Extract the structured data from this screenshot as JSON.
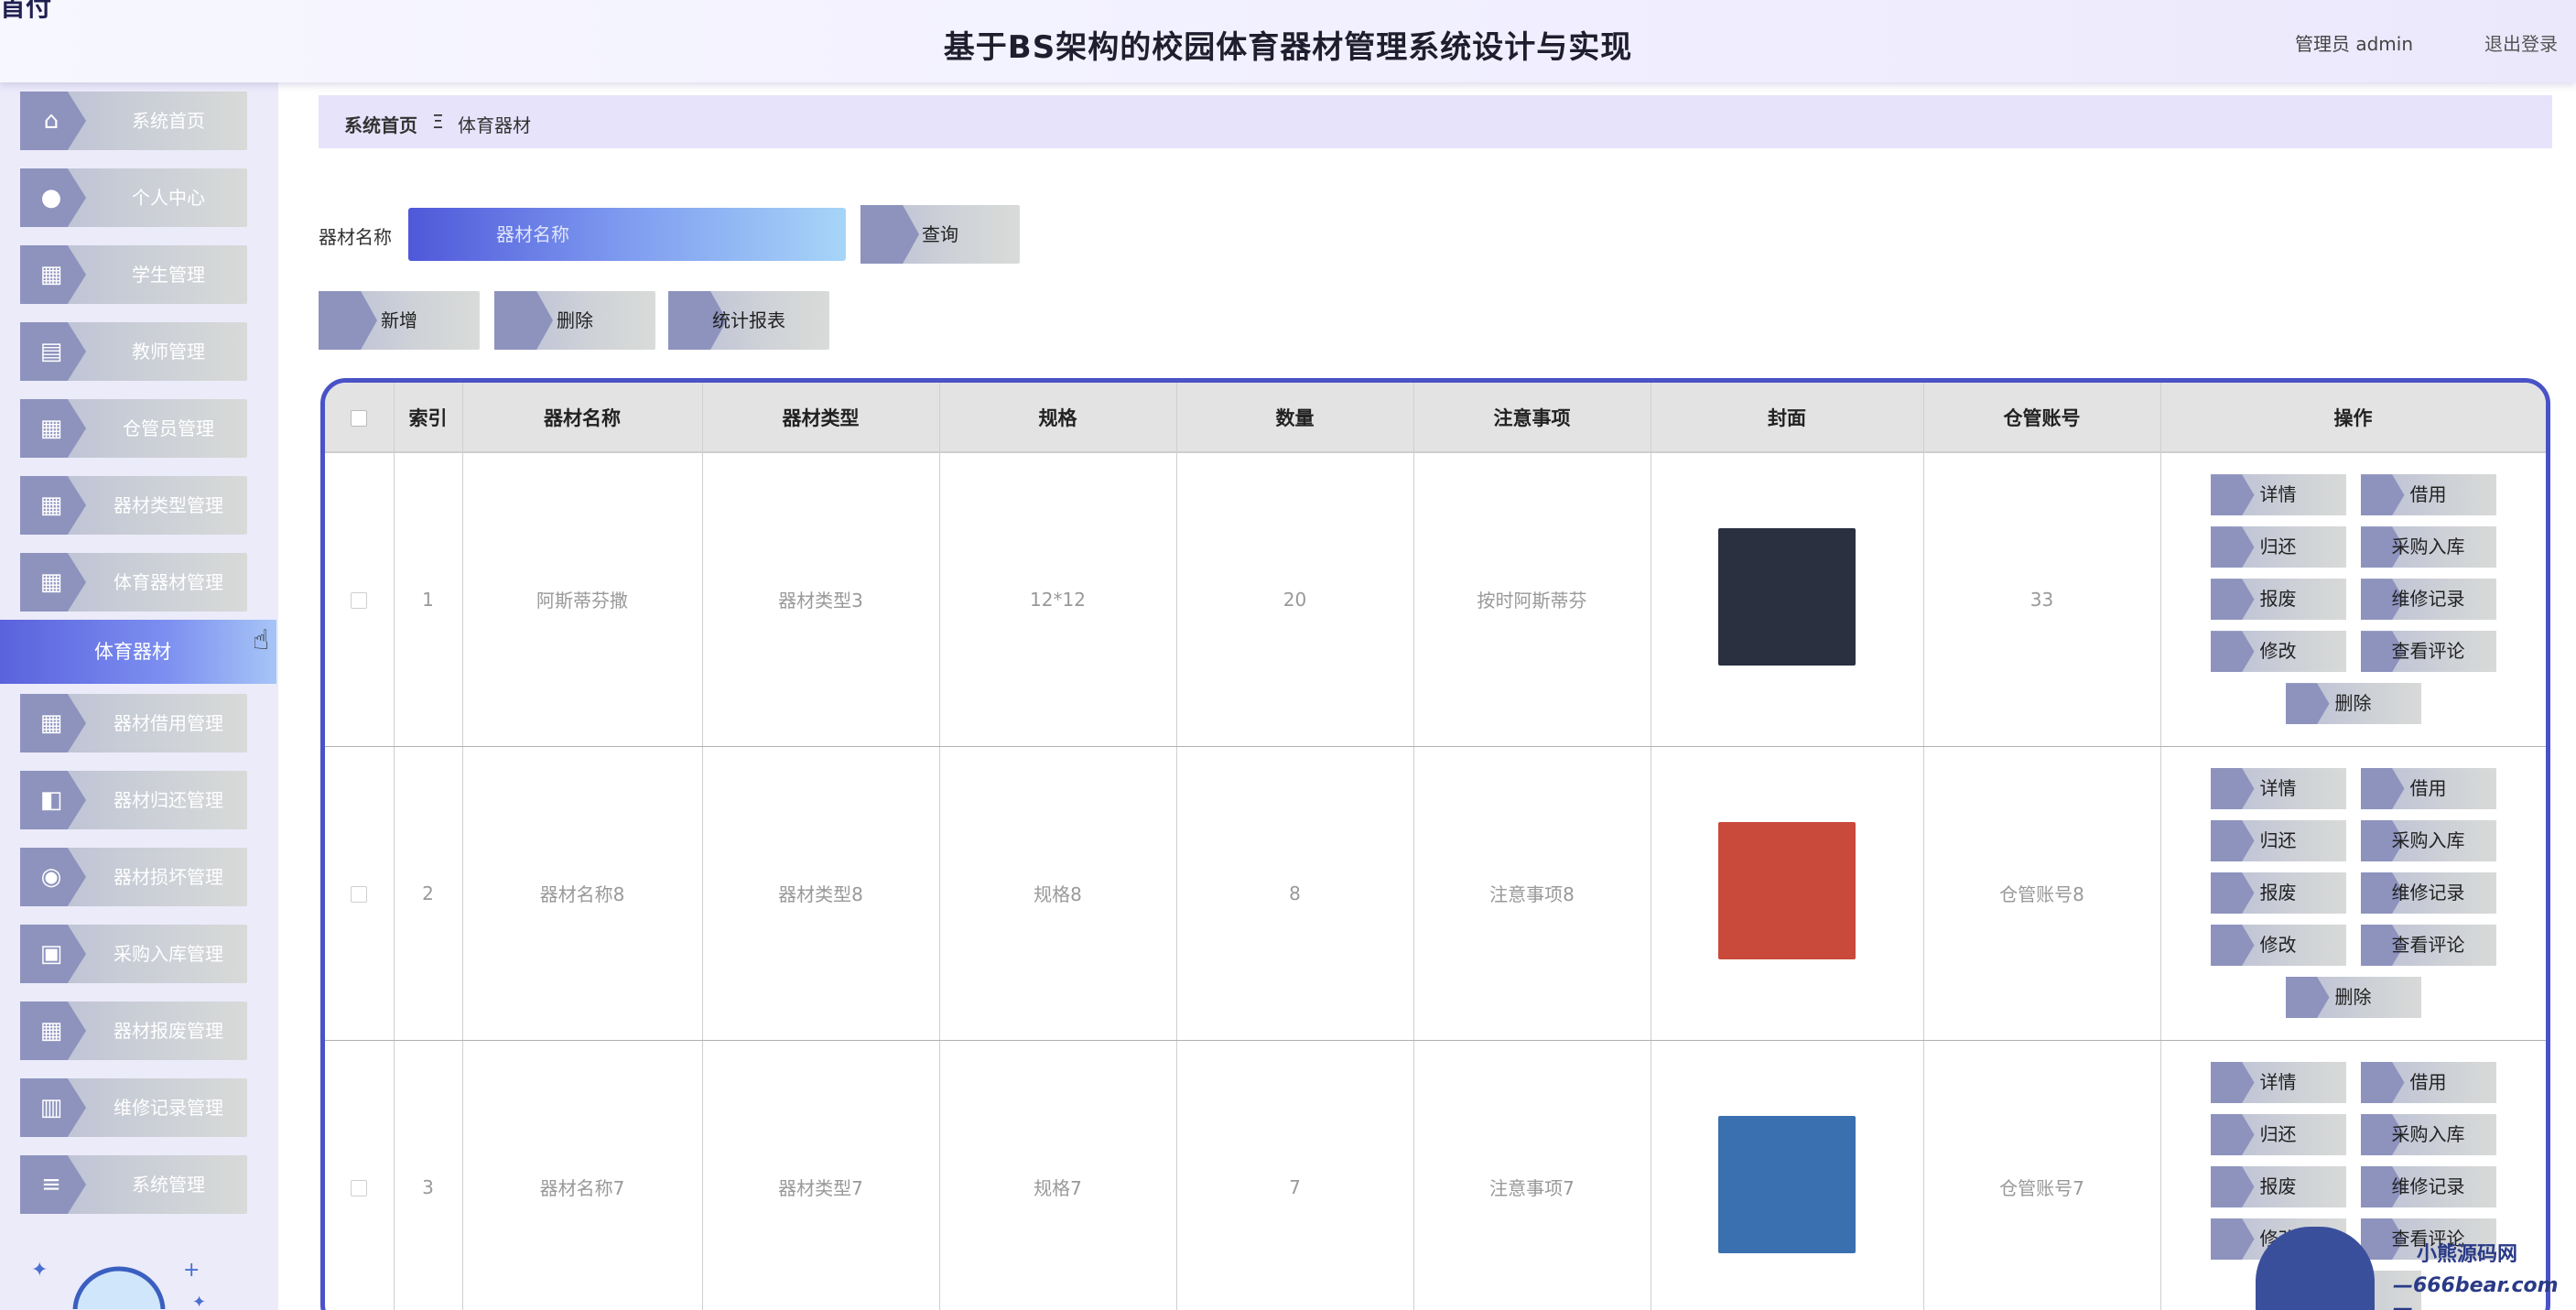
{
  "header": {
    "logo_text": "首付",
    "title": "基于BS架构的校园体育器材管理系统设计与实现",
    "user_label": "管理员 admin",
    "logout_label": "退出登录"
  },
  "sidebar": {
    "items": [
      {
        "label": "系统首页",
        "icon": "home-icon"
      },
      {
        "label": "个人中心",
        "icon": "user-icon"
      },
      {
        "label": "学生管理",
        "icon": "grid-icon"
      },
      {
        "label": "教师管理",
        "icon": "chart-icon"
      },
      {
        "label": "仓管员管理",
        "icon": "grid-icon"
      },
      {
        "label": "器材类型管理",
        "icon": "grid-icon"
      },
      {
        "label": "体育器材管理",
        "icon": "grid-icon"
      },
      {
        "label": "器材借用管理",
        "icon": "grid-icon"
      },
      {
        "label": "器材归还管理",
        "icon": "wallet-icon"
      },
      {
        "label": "器材损坏管理",
        "icon": "bulb-icon"
      },
      {
        "label": "采购入库管理",
        "icon": "clipboard-icon"
      },
      {
        "label": "器材报废管理",
        "icon": "grid-icon"
      },
      {
        "label": "维修记录管理",
        "icon": "bar-chart-icon"
      },
      {
        "label": "系统管理",
        "icon": "list-icon"
      }
    ],
    "active_label": "体育器材"
  },
  "breadcrumb": {
    "home": "系统首页",
    "separator": "Ξ",
    "current": "体育器材"
  },
  "search": {
    "label": "器材名称",
    "placeholder": "器材名称",
    "value": "",
    "query_button": "查询"
  },
  "toolbar": {
    "add": "新增",
    "delete": "删除",
    "report": "统计报表"
  },
  "table": {
    "headers": [
      "索引",
      "器材名称",
      "器材类型",
      "规格",
      "数量",
      "注意事项",
      "封面",
      "仓管账号",
      "操作"
    ],
    "rows": [
      {
        "index": "1",
        "name": "阿斯蒂芬撒",
        "type": "器材类型3",
        "spec": "12*12",
        "qty": "20",
        "notes": "按时阿斯蒂芬",
        "cover_color": "#2a3040",
        "account": "33"
      },
      {
        "index": "2",
        "name": "器材名称8",
        "type": "器材类型8",
        "spec": "规格8",
        "qty": "8",
        "notes": "注意事项8",
        "cover_color": "#c94a3a",
        "account": "仓管账号8"
      },
      {
        "index": "3",
        "name": "器材名称7",
        "type": "器材类型7",
        "spec": "规格7",
        "qty": "7",
        "notes": "注意事项7",
        "cover_color": "#3a6fb0",
        "account": "仓管账号7"
      }
    ],
    "actions": [
      "详情",
      "借用",
      "归还",
      "采购入库",
      "报废",
      "维修记录",
      "修改",
      "查看评论",
      "删除"
    ]
  },
  "watermark": {
    "line1": "小熊源码网",
    "line2": "—666bear.com—"
  },
  "colors": {
    "accent": "#4a52c7",
    "sidebar_bg": "#ecebfa",
    "breadcrumb_bg": "#e7e3fb",
    "button_tab": "#8d93bd"
  }
}
